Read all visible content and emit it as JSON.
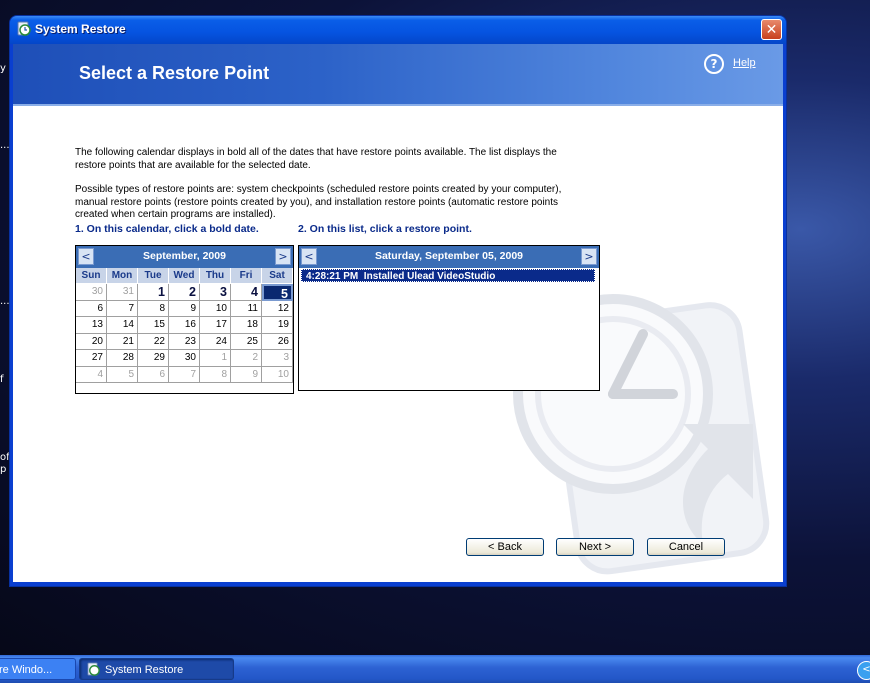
{
  "window": {
    "title": "System Restore",
    "close_label": "✕"
  },
  "header": {
    "title": "Select a Restore Point",
    "help_label": "Help"
  },
  "intro": {
    "para1_line1": "The following calendar displays in bold all of the dates that have restore points available. The list displays the",
    "para1_line2": "restore points that are available for the selected date.",
    "para2_line1": "Possible types of restore points are: system checkpoints (scheduled restore points created by your computer),",
    "para2_line2": "manual restore points (restore points created by you), and installation restore points (automatic restore points",
    "para2_line3": "created when certain programs are installed)."
  },
  "steps": {
    "step1": "1. On this calendar, click a bold date.",
    "step2": "2. On this list, click a restore point."
  },
  "calendar": {
    "month_label": "September, 2009",
    "prev": "<",
    "next": ">",
    "weekdays": [
      "Sun",
      "Mon",
      "Tue",
      "Wed",
      "Thu",
      "Fri",
      "Sat"
    ],
    "cells": [
      {
        "d": "30",
        "t": "other"
      },
      {
        "d": "31",
        "t": "other"
      },
      {
        "d": "1",
        "t": "bold"
      },
      {
        "d": "2",
        "t": "bold"
      },
      {
        "d": "3",
        "t": "bold"
      },
      {
        "d": "4",
        "t": "bold"
      },
      {
        "d": "5",
        "t": "sel"
      },
      {
        "d": "6",
        "t": ""
      },
      {
        "d": "7",
        "t": ""
      },
      {
        "d": "8",
        "t": ""
      },
      {
        "d": "9",
        "t": ""
      },
      {
        "d": "10",
        "t": ""
      },
      {
        "d": "11",
        "t": ""
      },
      {
        "d": "12",
        "t": ""
      },
      {
        "d": "13",
        "t": ""
      },
      {
        "d": "14",
        "t": ""
      },
      {
        "d": "15",
        "t": ""
      },
      {
        "d": "16",
        "t": ""
      },
      {
        "d": "17",
        "t": ""
      },
      {
        "d": "18",
        "t": ""
      },
      {
        "d": "19",
        "t": ""
      },
      {
        "d": "20",
        "t": ""
      },
      {
        "d": "21",
        "t": ""
      },
      {
        "d": "22",
        "t": ""
      },
      {
        "d": "23",
        "t": ""
      },
      {
        "d": "24",
        "t": ""
      },
      {
        "d": "25",
        "t": ""
      },
      {
        "d": "26",
        "t": ""
      },
      {
        "d": "27",
        "t": ""
      },
      {
        "d": "28",
        "t": ""
      },
      {
        "d": "29",
        "t": ""
      },
      {
        "d": "30",
        "t": ""
      },
      {
        "d": "1",
        "t": "other"
      },
      {
        "d": "2",
        "t": "other"
      },
      {
        "d": "3",
        "t": "other"
      },
      {
        "d": "4",
        "t": "other"
      },
      {
        "d": "5",
        "t": "other"
      },
      {
        "d": "6",
        "t": "other"
      },
      {
        "d": "7",
        "t": "other"
      },
      {
        "d": "8",
        "t": "other"
      },
      {
        "d": "9",
        "t": "other"
      },
      {
        "d": "10",
        "t": "other"
      }
    ]
  },
  "restore_list": {
    "date_label": "Saturday, September 05, 2009",
    "prev": "<",
    "next": ">",
    "items": [
      "4:28:21 PM  Installed Ulead VideoStudio"
    ]
  },
  "buttons": {
    "back": "< Back",
    "next": "Next >",
    "cancel": "Cancel"
  },
  "desktop_fragments": [
    "y",
    "...",
    "...",
    "f",
    "oft",
    "p"
  ],
  "taskbar": {
    "item1": "re Windo...",
    "item2": "System Restore",
    "tray_arrow": "<"
  },
  "colors": {
    "title_bar": "#0553e0",
    "header_band": "#2c62c8",
    "calendar_header": "#3a6db5",
    "selection": "#0a2a8a",
    "taskbar": "#2d62d3"
  }
}
